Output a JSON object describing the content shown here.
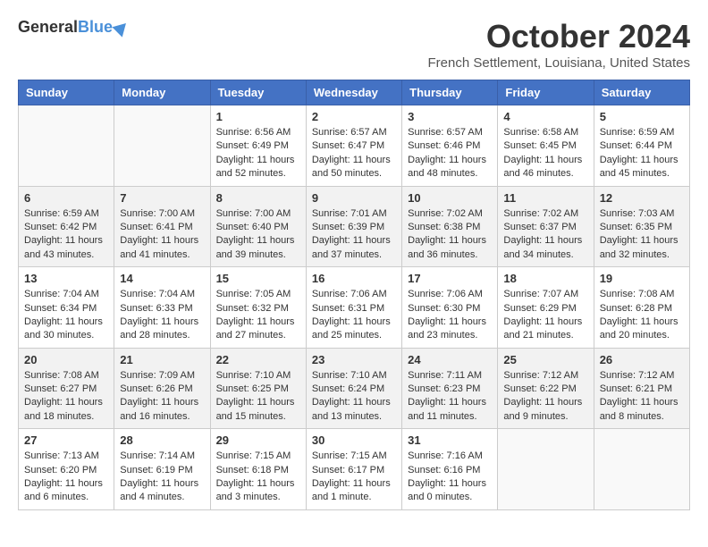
{
  "header": {
    "logo_general": "General",
    "logo_blue": "Blue",
    "month_title": "October 2024",
    "location": "French Settlement, Louisiana, United States"
  },
  "days_of_week": [
    "Sunday",
    "Monday",
    "Tuesday",
    "Wednesday",
    "Thursday",
    "Friday",
    "Saturday"
  ],
  "weeks": [
    [
      {
        "day": "",
        "content": ""
      },
      {
        "day": "",
        "content": ""
      },
      {
        "day": "1",
        "content": "Sunrise: 6:56 AM\nSunset: 6:49 PM\nDaylight: 11 hours and 52 minutes."
      },
      {
        "day": "2",
        "content": "Sunrise: 6:57 AM\nSunset: 6:47 PM\nDaylight: 11 hours and 50 minutes."
      },
      {
        "day": "3",
        "content": "Sunrise: 6:57 AM\nSunset: 6:46 PM\nDaylight: 11 hours and 48 minutes."
      },
      {
        "day": "4",
        "content": "Sunrise: 6:58 AM\nSunset: 6:45 PM\nDaylight: 11 hours and 46 minutes."
      },
      {
        "day": "5",
        "content": "Sunrise: 6:59 AM\nSunset: 6:44 PM\nDaylight: 11 hours and 45 minutes."
      }
    ],
    [
      {
        "day": "6",
        "content": "Sunrise: 6:59 AM\nSunset: 6:42 PM\nDaylight: 11 hours and 43 minutes."
      },
      {
        "day": "7",
        "content": "Sunrise: 7:00 AM\nSunset: 6:41 PM\nDaylight: 11 hours and 41 minutes."
      },
      {
        "day": "8",
        "content": "Sunrise: 7:00 AM\nSunset: 6:40 PM\nDaylight: 11 hours and 39 minutes."
      },
      {
        "day": "9",
        "content": "Sunrise: 7:01 AM\nSunset: 6:39 PM\nDaylight: 11 hours and 37 minutes."
      },
      {
        "day": "10",
        "content": "Sunrise: 7:02 AM\nSunset: 6:38 PM\nDaylight: 11 hours and 36 minutes."
      },
      {
        "day": "11",
        "content": "Sunrise: 7:02 AM\nSunset: 6:37 PM\nDaylight: 11 hours and 34 minutes."
      },
      {
        "day": "12",
        "content": "Sunrise: 7:03 AM\nSunset: 6:35 PM\nDaylight: 11 hours and 32 minutes."
      }
    ],
    [
      {
        "day": "13",
        "content": "Sunrise: 7:04 AM\nSunset: 6:34 PM\nDaylight: 11 hours and 30 minutes."
      },
      {
        "day": "14",
        "content": "Sunrise: 7:04 AM\nSunset: 6:33 PM\nDaylight: 11 hours and 28 minutes."
      },
      {
        "day": "15",
        "content": "Sunrise: 7:05 AM\nSunset: 6:32 PM\nDaylight: 11 hours and 27 minutes."
      },
      {
        "day": "16",
        "content": "Sunrise: 7:06 AM\nSunset: 6:31 PM\nDaylight: 11 hours and 25 minutes."
      },
      {
        "day": "17",
        "content": "Sunrise: 7:06 AM\nSunset: 6:30 PM\nDaylight: 11 hours and 23 minutes."
      },
      {
        "day": "18",
        "content": "Sunrise: 7:07 AM\nSunset: 6:29 PM\nDaylight: 11 hours and 21 minutes."
      },
      {
        "day": "19",
        "content": "Sunrise: 7:08 AM\nSunset: 6:28 PM\nDaylight: 11 hours and 20 minutes."
      }
    ],
    [
      {
        "day": "20",
        "content": "Sunrise: 7:08 AM\nSunset: 6:27 PM\nDaylight: 11 hours and 18 minutes."
      },
      {
        "day": "21",
        "content": "Sunrise: 7:09 AM\nSunset: 6:26 PM\nDaylight: 11 hours and 16 minutes."
      },
      {
        "day": "22",
        "content": "Sunrise: 7:10 AM\nSunset: 6:25 PM\nDaylight: 11 hours and 15 minutes."
      },
      {
        "day": "23",
        "content": "Sunrise: 7:10 AM\nSunset: 6:24 PM\nDaylight: 11 hours and 13 minutes."
      },
      {
        "day": "24",
        "content": "Sunrise: 7:11 AM\nSunset: 6:23 PM\nDaylight: 11 hours and 11 minutes."
      },
      {
        "day": "25",
        "content": "Sunrise: 7:12 AM\nSunset: 6:22 PM\nDaylight: 11 hours and 9 minutes."
      },
      {
        "day": "26",
        "content": "Sunrise: 7:12 AM\nSunset: 6:21 PM\nDaylight: 11 hours and 8 minutes."
      }
    ],
    [
      {
        "day": "27",
        "content": "Sunrise: 7:13 AM\nSunset: 6:20 PM\nDaylight: 11 hours and 6 minutes."
      },
      {
        "day": "28",
        "content": "Sunrise: 7:14 AM\nSunset: 6:19 PM\nDaylight: 11 hours and 4 minutes."
      },
      {
        "day": "29",
        "content": "Sunrise: 7:15 AM\nSunset: 6:18 PM\nDaylight: 11 hours and 3 minutes."
      },
      {
        "day": "30",
        "content": "Sunrise: 7:15 AM\nSunset: 6:17 PM\nDaylight: 11 hours and 1 minute."
      },
      {
        "day": "31",
        "content": "Sunrise: 7:16 AM\nSunset: 6:16 PM\nDaylight: 11 hours and 0 minutes."
      },
      {
        "day": "",
        "content": ""
      },
      {
        "day": "",
        "content": ""
      }
    ]
  ]
}
